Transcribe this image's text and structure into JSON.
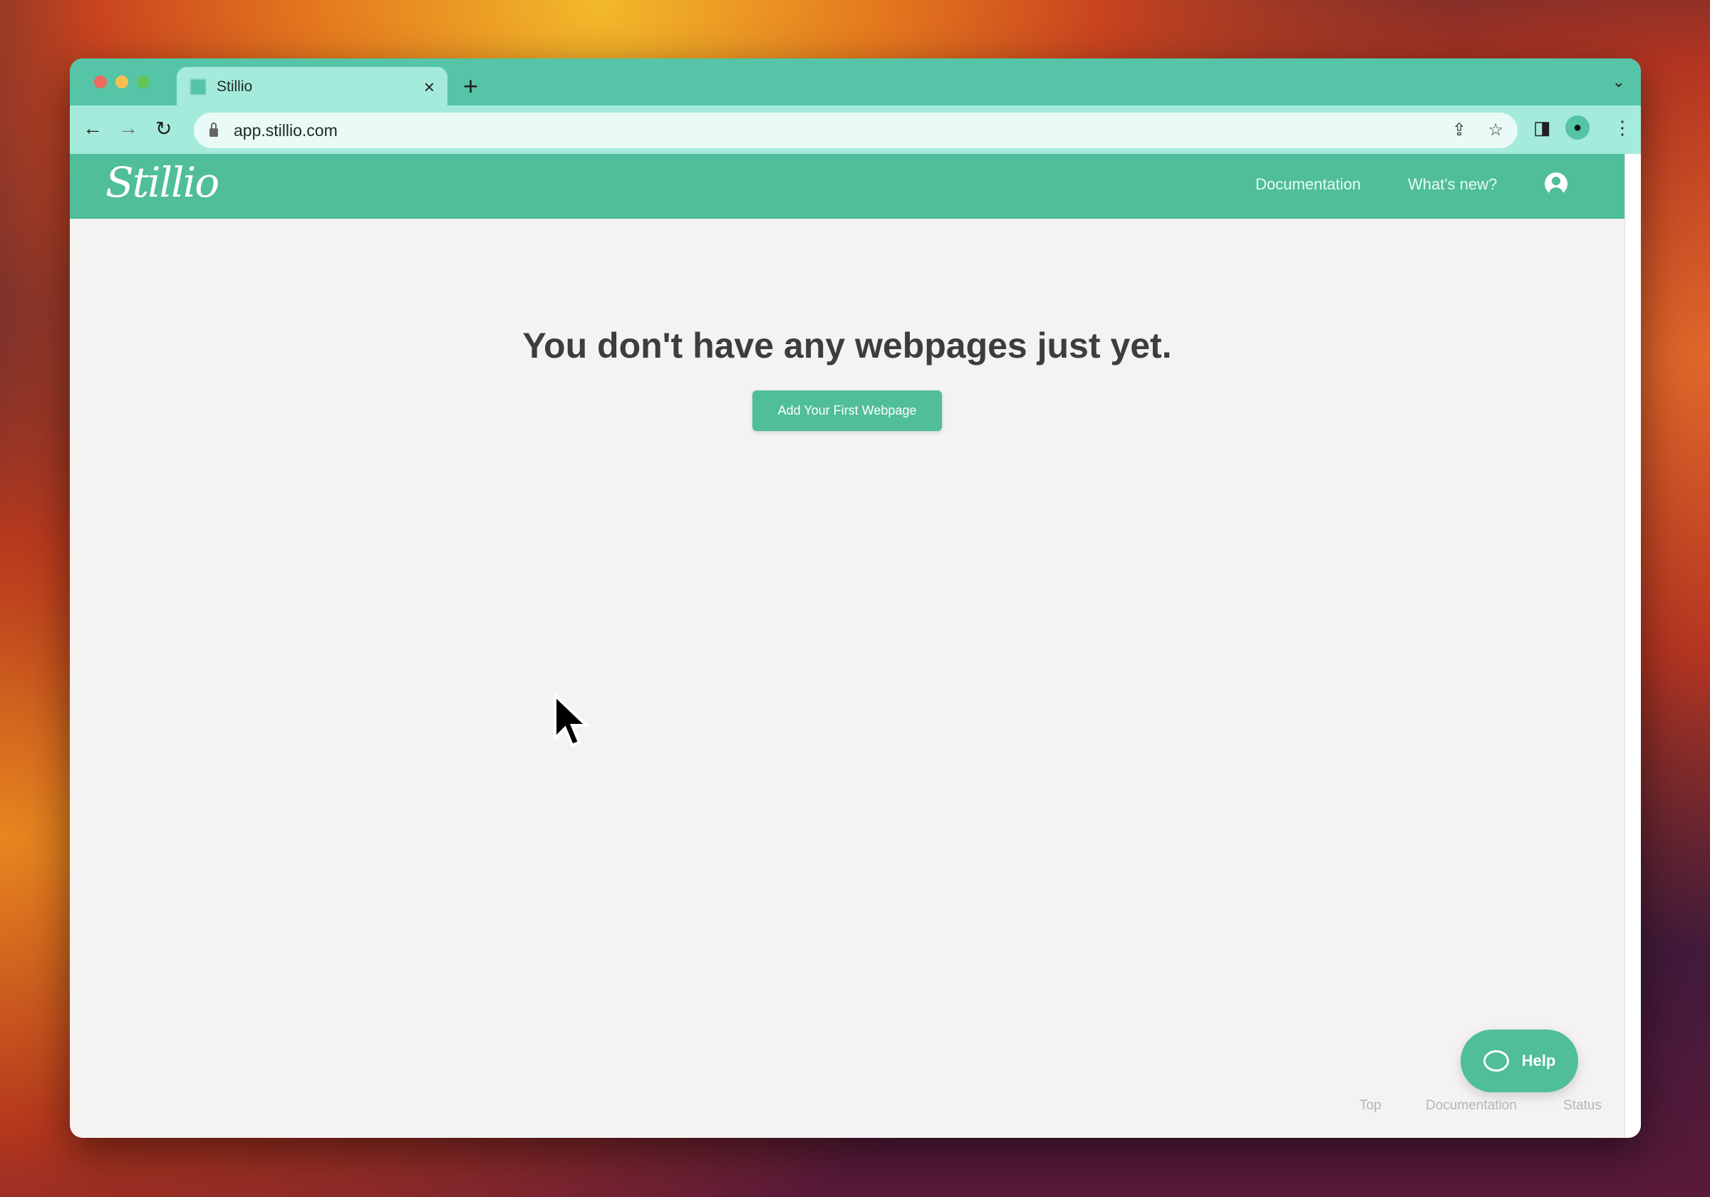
{
  "browser": {
    "tab_title": "Stillio",
    "url": "app.stillio.com",
    "accent": "#56c4a6"
  },
  "header": {
    "logo": "Stillio",
    "links": [
      "Documentation",
      "What's new?"
    ]
  },
  "main": {
    "heading": "You don't have any webpages just yet.",
    "cta": "Add Your First Webpage"
  },
  "help": {
    "label": "Help"
  },
  "footer": {
    "links": [
      "Top",
      "Documentation",
      "Status"
    ]
  },
  "brand_color": "#50bd9b"
}
